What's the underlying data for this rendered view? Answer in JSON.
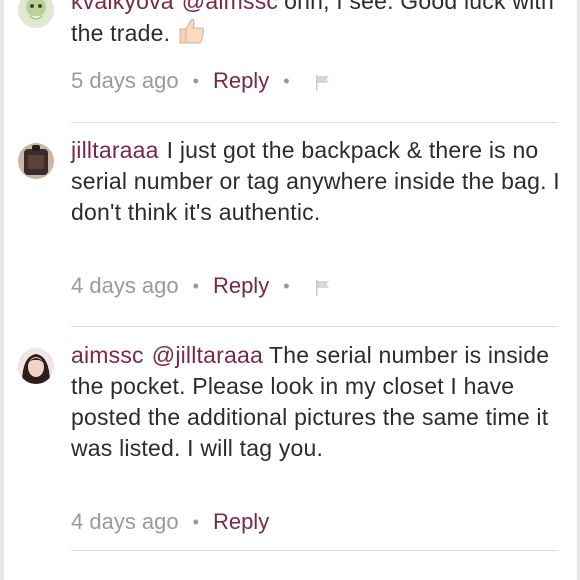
{
  "comments": [
    {
      "username": "kvalkyova",
      "mention": "@aimssc",
      "body": "ohh, I see. Good luck with the trade.",
      "time": "5 days ago",
      "reply_label": "Reply",
      "icons": [
        "avatar",
        "thumbs-up-icon",
        "flag-icon"
      ]
    },
    {
      "username": "jilltaraaa",
      "body": "I just got the backpack & there is no serial number or tag anywhere inside the bag. I don't think it's authentic.",
      "time": "4 days ago",
      "reply_label": "Reply",
      "icons": [
        "avatar",
        "flag-icon"
      ]
    },
    {
      "username": "aimssc",
      "mention": "@jilltaraaa",
      "body": "The serial number is inside the pocket. Please look in my closet I have posted the additional pictures the same time it was listed. I will tag you.",
      "time": "4 days ago",
      "reply_label": "Reply",
      "icons": [
        "avatar"
      ]
    }
  ],
  "colors": {
    "accent": "#7a2943",
    "text": "#2c2c2c",
    "muted": "#9a9a9a",
    "divider": "#dedede"
  }
}
